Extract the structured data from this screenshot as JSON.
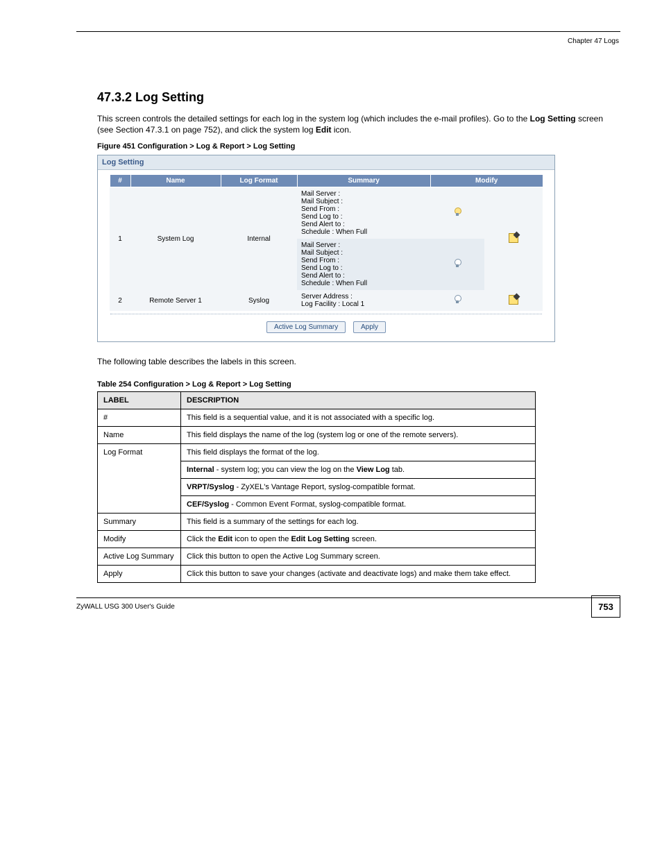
{
  "header": {
    "chapter": "Chapter 47 Logs"
  },
  "section": {
    "subhead": "47.3.2  Log Setting",
    "para1_a": "This screen controls the detailed settings for each log in the system log (which includes the e-mail profiles). Go to the ",
    "para1_b": "Log Setting",
    "para1_c": " screen (see Section 47.3.1 on page 752), and click the system log ",
    "para1_d": "Edit",
    "para1_e": " icon.",
    "figure_label": "Figure 451   Configuration > Log & Report > Log Setting",
    "intro_table": "The following table describes the labels in this screen.",
    "table_label": "Table 254   Configuration > Log & Report > Log Setting"
  },
  "screenshot": {
    "title": "Log Setting",
    "columns": {
      "num": "#",
      "name": "Name",
      "format": "Log Format",
      "summary": "Summary",
      "modify": "Modify"
    },
    "rows": [
      {
        "num": "1",
        "name": "System Log",
        "format": "Internal",
        "summary1": "Mail Server :\nMail Subject :\nSend From :\nSend Log to :\nSend Alert to :\nSchedule : When Full",
        "summary2": "Mail Server :\nMail Subject :\nSend From :\nSend Log to :\nSend Alert to :\nSchedule : When Full"
      },
      {
        "num": "2",
        "name": "Remote Server 1",
        "format": "Syslog",
        "summary": "Server Address :\nLog Facility : Local 1"
      }
    ],
    "buttons": {
      "summary": "Active Log Summary",
      "apply": "Apply"
    }
  },
  "desc_table": {
    "headers": {
      "label": "LABEL",
      "desc": "DESCRIPTION"
    },
    "rows": [
      {
        "label": "#",
        "desc": "This field is a sequential value, and it is not associated with a specific log."
      },
      {
        "label": "Name",
        "desc": "This field displays the name of the log (system log or one of the remote servers)."
      },
      {
        "label": "Log Format",
        "desc": "This field displays the format of the log."
      },
      {
        "label": "",
        "desc_a": "Internal",
        "desc_b": " - system log; you can view the log on the ",
        "desc_c": "View Log",
        "desc_d": " tab."
      },
      {
        "label": "",
        "desc_a": "VRPT/Syslog",
        "desc_b": " - ZyXEL's Vantage Report, syslog-compatible format.",
        "desc_c": "",
        "desc_d": ""
      },
      {
        "label": "",
        "desc_a": "CEF/Syslog",
        "desc_b": " - Common Event Format, syslog-compatible format.",
        "desc_c": "",
        "desc_d": ""
      },
      {
        "label": "Summary",
        "desc": "This field is a summary of the settings for each log."
      },
      {
        "label": "Modify",
        "desc_a": "Click the ",
        "desc_b": "Edit",
        "desc_c": " icon to open the ",
        "desc_d": "Edit Log Setting",
        "desc_e": " screen."
      },
      {
        "label": "Active Log Summary",
        "desc": "Click this button to open the Active Log Summary screen."
      },
      {
        "label": "Apply",
        "desc": "Click this button to save your changes (activate and deactivate logs) and make them take effect."
      }
    ]
  },
  "footer": {
    "guide": "ZyWALL USG 300 User's Guide",
    "page": "753"
  }
}
